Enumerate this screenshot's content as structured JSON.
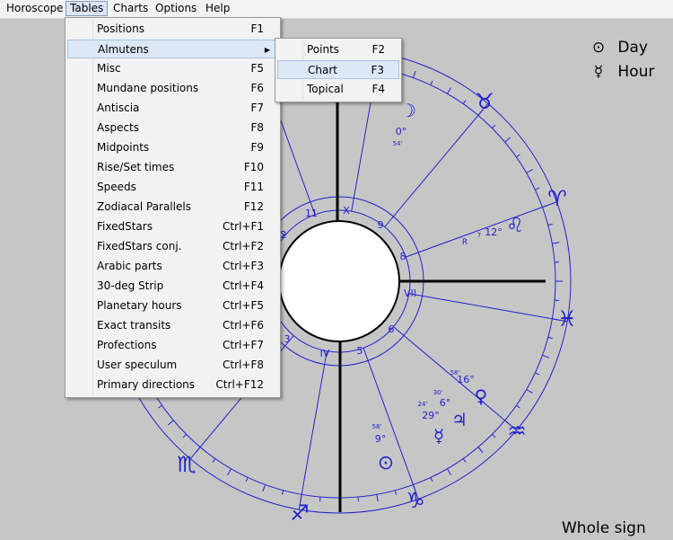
{
  "menubar": [
    "Horoscope",
    "Tables",
    "Charts",
    "Options",
    "Help"
  ],
  "info": {
    "day_glyph": "⊙",
    "day_label": "Day",
    "hour_glyph": "☿",
    "hour_label": "Hour",
    "house_system": "Whole sign"
  },
  "tables_menu": [
    {
      "label": "Positions",
      "shortcut": "F1"
    },
    {
      "label": "Almutens",
      "shortcut": "",
      "submenu": true
    },
    {
      "label": "Misc",
      "shortcut": "F5"
    },
    {
      "label": "Mundane positions",
      "shortcut": "F6"
    },
    {
      "label": "Antiscia",
      "shortcut": "F7"
    },
    {
      "label": "Aspects",
      "shortcut": "F8"
    },
    {
      "label": "Midpoints",
      "shortcut": "F9"
    },
    {
      "label": "Rise/Set times",
      "shortcut": "F10"
    },
    {
      "label": "Speeds",
      "shortcut": "F11"
    },
    {
      "label": "Zodiacal Parallels",
      "shortcut": "F12"
    },
    {
      "label": "FixedStars",
      "shortcut": "Ctrl+F1"
    },
    {
      "label": "FixedStars conj.",
      "shortcut": "Ctrl+F2"
    },
    {
      "label": "Arabic parts",
      "shortcut": "Ctrl+F3"
    },
    {
      "label": "30-deg Strip",
      "shortcut": "Ctrl+F4"
    },
    {
      "label": "Planetary hours",
      "shortcut": "Ctrl+F5"
    },
    {
      "label": "Exact transits",
      "shortcut": "Ctrl+F6"
    },
    {
      "label": "Profections",
      "shortcut": "Ctrl+F7"
    },
    {
      "label": "User speculum",
      "shortcut": "Ctrl+F8"
    },
    {
      "label": "Primary directions",
      "shortcut": "Ctrl+F12"
    }
  ],
  "almutens_submenu": [
    {
      "label": "Points",
      "shortcut": "F2"
    },
    {
      "label": "Chart",
      "shortcut": "F3"
    },
    {
      "label": "Topical",
      "shortcut": "F4"
    }
  ],
  "chart": {
    "house_numbers": [
      "X",
      "11",
      "9",
      "8",
      "VII",
      "6",
      "5",
      "IV",
      "3",
      "2"
    ],
    "sign_glyphs": [
      "♉",
      "♈",
      "♌",
      "♓",
      "♒",
      "♑",
      "♐",
      "♏"
    ],
    "planets": [
      {
        "glyph": "☽",
        "degree": "0°",
        "minute": "54'"
      },
      {
        "glyph": "♌",
        "degree": "12°",
        "minute": "7",
        "retro": "R"
      },
      {
        "glyph": "♀",
        "degree": "16°",
        "minute": "58'"
      },
      {
        "glyph": "♃",
        "degree": "6°",
        "minute": "30'"
      },
      {
        "glyph": "☿",
        "degree": "29°",
        "minute": "24'"
      },
      {
        "glyph": "⊙",
        "degree": "9°",
        "minute": "58'"
      }
    ]
  }
}
